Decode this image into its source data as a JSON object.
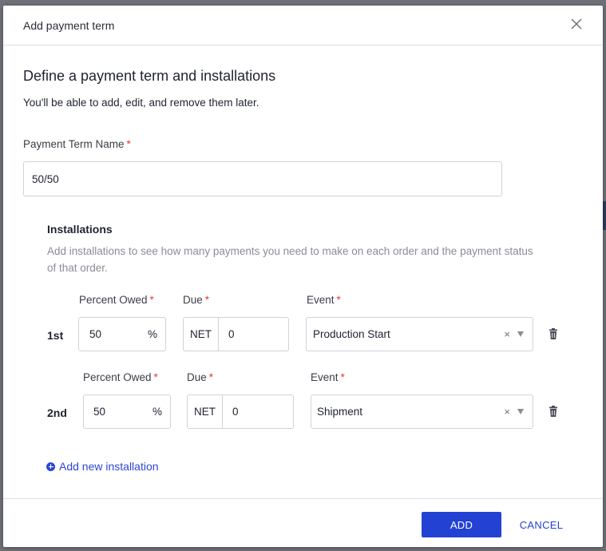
{
  "dialog": {
    "title": "Add payment term",
    "heading": "Define a payment term and installations",
    "subheading": "You'll be able to add, edit, and remove them later."
  },
  "payment_term": {
    "label": "Payment Term Name",
    "required_mark": "*",
    "value": "50/50"
  },
  "installations": {
    "heading": "Installations",
    "description": "Add installations to see how many payments you need to make on each order and the payment status of that order.",
    "percent_label": "Percent Owed",
    "due_label": "Due",
    "event_label": "Event",
    "required_mark": "*",
    "percent_suffix": "%",
    "net_prefix": "NET",
    "clear_glyph": "×",
    "rows": [
      {
        "ordinal": "1st",
        "percent": "50",
        "due": "0",
        "event": "Production Start"
      },
      {
        "ordinal": "2nd",
        "percent": "50",
        "due": "0",
        "event": "Shipment"
      }
    ],
    "add_link": "Add new installation"
  },
  "footer": {
    "add_label": "ADD",
    "cancel_label": "CANCEL"
  },
  "colors": {
    "primary": "#2342d4",
    "required": "#e03a3a",
    "muted_text": "#8a8d96"
  },
  "icons": {
    "close": "close-icon",
    "trash": "trash-icon",
    "plus": "plus-circle-icon",
    "caret": "chevron-down-icon"
  }
}
